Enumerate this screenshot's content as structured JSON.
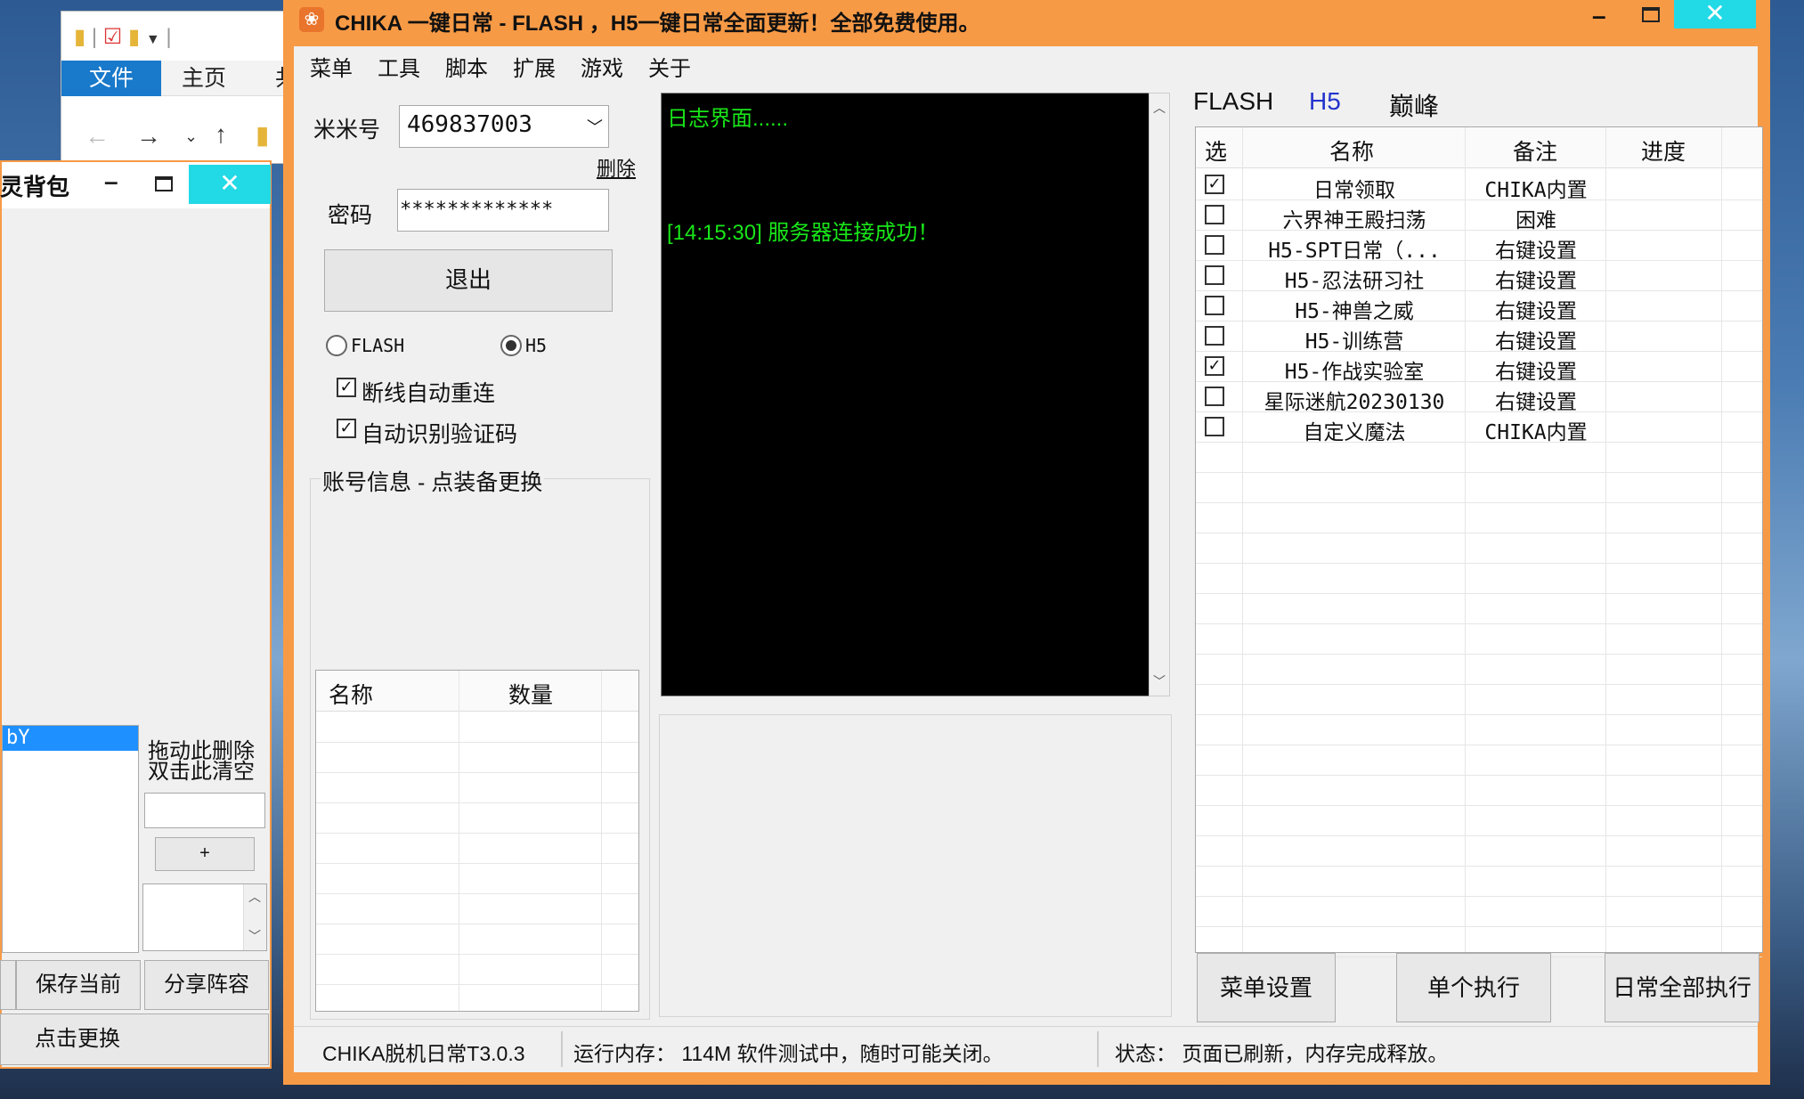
{
  "explorer": {
    "file_tab": "文件",
    "home_tab": "主页",
    "partial_tab": "共"
  },
  "left_window": {
    "title": "精灵背包",
    "list_item": "bY",
    "drag_hint_1": "拖动此删除",
    "drag_hint_2": "双击此清空",
    "plus_label": "+",
    "save_label": "保存当前",
    "share_label": "分享阵容",
    "replace_label": "点击更换"
  },
  "main_window": {
    "title": "CHIKA 一键日常 - FLASH ，H5一键日常全面更新！全部免费使用。",
    "menu": [
      "菜单",
      "工具",
      "脚本",
      "扩展",
      "游戏",
      "关于"
    ],
    "account_label": "米米号",
    "account_value": "469837003",
    "delete_link": "删除",
    "password_label": "密码",
    "password_value": "*************",
    "logout_label": "退出",
    "radio_flash": "FLASH",
    "radio_h5": "H5",
    "auto_reconnect": "断线自动重连",
    "auto_captcha": "自动识别验证码",
    "account_info": "账号信息 - 点装备更换",
    "equip_cols": [
      "名称",
      "数量"
    ],
    "log_title": "日志界面......",
    "log_line": "[14:15:30] 服务器连接成功！",
    "tabs": [
      "FLASH",
      "H5",
      "巅峰"
    ],
    "task_cols": [
      "选",
      "名称",
      "备注",
      "进度"
    ],
    "tasks": [
      {
        "name": "日常领取",
        "note": "CHIKA内置",
        "checked": true
      },
      {
        "name": "六界神王殿扫荡",
        "note": "困难",
        "checked": false
      },
      {
        "name": "H5-SPT日常（...",
        "note": "右键设置",
        "checked": false
      },
      {
        "name": "H5-忍法研习社",
        "note": "右键设置",
        "checked": false
      },
      {
        "name": "H5-神兽之威",
        "note": "右键设置",
        "checked": false
      },
      {
        "name": "H5-训练营",
        "note": "右键设置",
        "checked": false
      },
      {
        "name": "H5-作战实验室",
        "note": "右键设置",
        "checked": true
      },
      {
        "name": "星际迷航20230130",
        "note": "右键设置",
        "checked": false
      },
      {
        "name": "自定义魔法",
        "note": "CHIKA内置",
        "checked": false
      }
    ],
    "btn_menu_settings": "菜单设置",
    "btn_single": "单个执行",
    "btn_all": "日常全部执行",
    "status_version": "CHIKA脱机日常T3.0.3",
    "status_memory": "运行内存： 114M 软件测试中，随时可能关闭。",
    "status_state": "状态： 页面已刷新，内存完成释放。"
  },
  "colors": {
    "accent_orange": "#f79a46",
    "log_text": "#19e619",
    "tab_active": "#2233cc",
    "close_cyan": "#22d9e6",
    "selection_blue": "#1e90ff"
  }
}
